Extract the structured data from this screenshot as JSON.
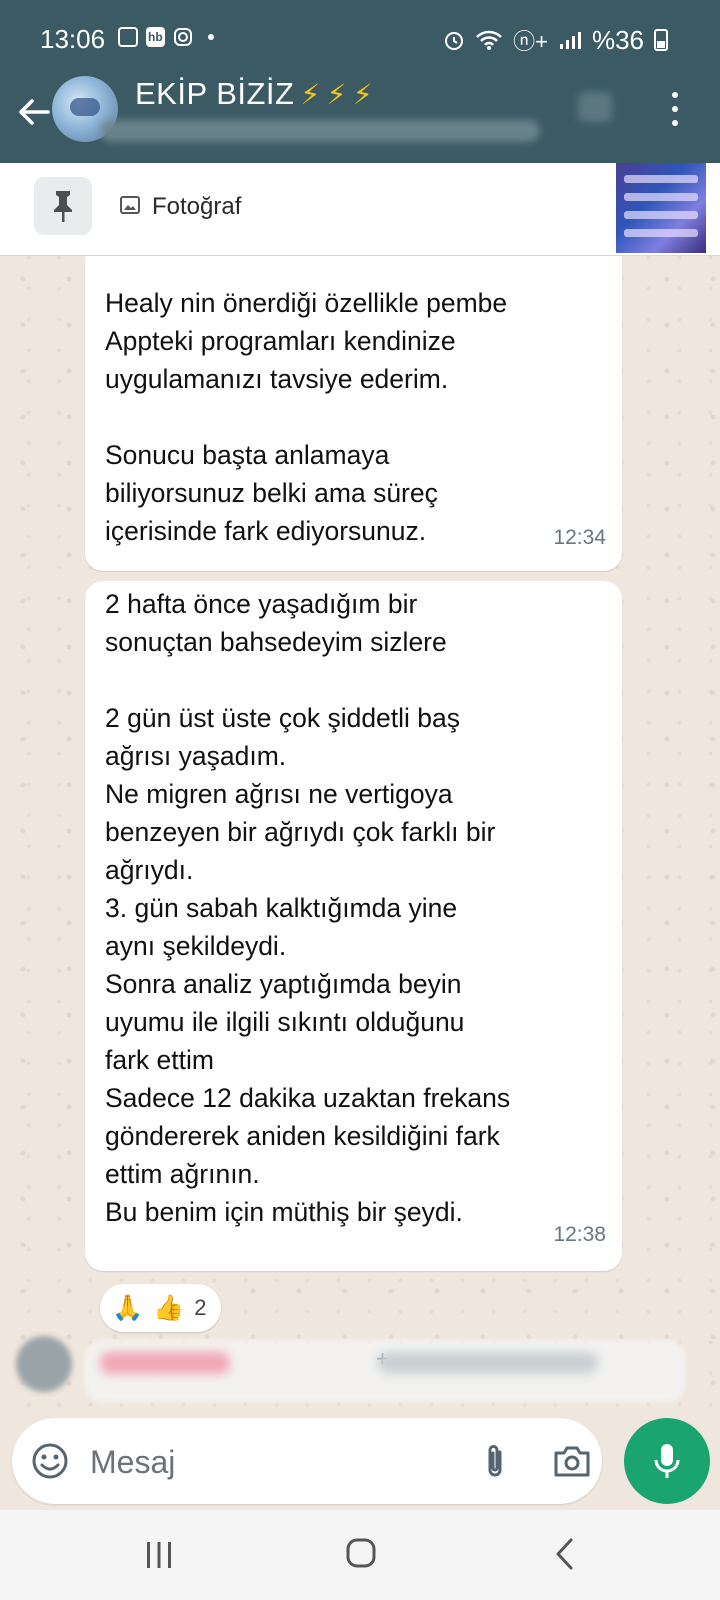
{
  "status_bar": {
    "time": "13:06",
    "left_icons": [
      "gallery-icon",
      "hb-app-icon",
      "instagram-icon",
      "dot-icon"
    ],
    "hb_label": "hb",
    "network": "ⓝ+",
    "battery": "%36",
    "right_icons": [
      "alarm-icon",
      "wifi-icon",
      "hd-plus-icon",
      "signal-icon",
      "battery-icon"
    ]
  },
  "header": {
    "group_name": "EKİP BİZİZ",
    "title_emojis": [
      "⚡",
      "⚡",
      "⚡"
    ]
  },
  "pinned": {
    "label": "Fotoğraf"
  },
  "messages": [
    {
      "text": "Healy nin önerdiği özellikle pembe\nAppteki programları kendinize\nuygulamanızı tavsiye ederim.\n\nSonucu başta anlamaya\nbiliyorsunuz belki ama süreç\niçerisinde fark ediyorsunuz.",
      "time": "12:34"
    },
    {
      "text": "2 hafta önce yaşadığım bir\nsonuçtan bahsedeyim sizlere\n\n2 gün üst üste çok şiddetli baş\nağrısı yaşadım.\nNe migren ağrısı ne vertigoya\nbenzeyen bir ağrıydı  çok farklı bir\nağrıydı.\n 3. gün sabah kalktığımda yine\naynı şekildeydi.\nSonra analiz yaptığımda beyin\nuyumu ile ilgili sıkıntı olduğunu\nfark ettim\nSadece 12 dakika uzaktan frekans\ngöndererek aniden kesildiğini fark\nettim ağrının.\nBu benim için müthiş bir şeydi.",
      "time": "12:38",
      "reactions": {
        "emojis": [
          "🙏",
          "👍"
        ],
        "count": "2"
      }
    }
  ],
  "next_message_preview": {
    "plus": "+"
  },
  "composer": {
    "placeholder": "Mesaj"
  },
  "colors": {
    "header_bg": "#3b5a64",
    "chat_bg": "#efe7dd",
    "accent_green": "#1aa470",
    "bubble_bg": "#ffffff",
    "time_text": "#667781"
  }
}
